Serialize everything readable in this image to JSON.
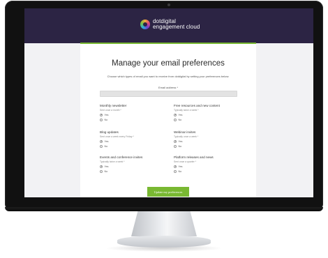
{
  "brand": {
    "name_line1": "dotdigital",
    "name_line2": "engagement cloud",
    "colors": {
      "header": "#2c2444",
      "accent": "#79b832"
    }
  },
  "page": {
    "title": "Manage your email preferences",
    "intro": "Choose which types of email you want to receive from dotdigital by setting your preferences below:",
    "email_label": "Email address *",
    "email_value": ""
  },
  "preferences": [
    {
      "title": "Monthly newsletter",
      "subtitle": "Sent once a month *",
      "options": [
        "Yes",
        "No"
      ],
      "selected": "Yes"
    },
    {
      "title": "Free resources and new content",
      "subtitle": "Typically twice a week *",
      "options": [
        "Yes",
        "No"
      ],
      "selected": "Yes"
    },
    {
      "title": "Blog updates",
      "subtitle": "Sent once a week every Friday *",
      "options": [
        "Yes",
        "No"
      ],
      "selected": "Yes"
    },
    {
      "title": "Webinar invites",
      "subtitle": "Typically once a week *",
      "options": [
        "Yes",
        "No"
      ],
      "selected": "Yes"
    },
    {
      "title": "Events and conference invites",
      "subtitle": "Typically twice a week *",
      "options": [
        "Yes",
        "No"
      ],
      "selected": "Yes"
    },
    {
      "title": "Platform releases and news",
      "subtitle": "Sent once a quarter *",
      "options": [
        "Yes",
        "No"
      ],
      "selected": "Yes"
    }
  ],
  "actions": {
    "submit_label": "Update my preferences"
  }
}
